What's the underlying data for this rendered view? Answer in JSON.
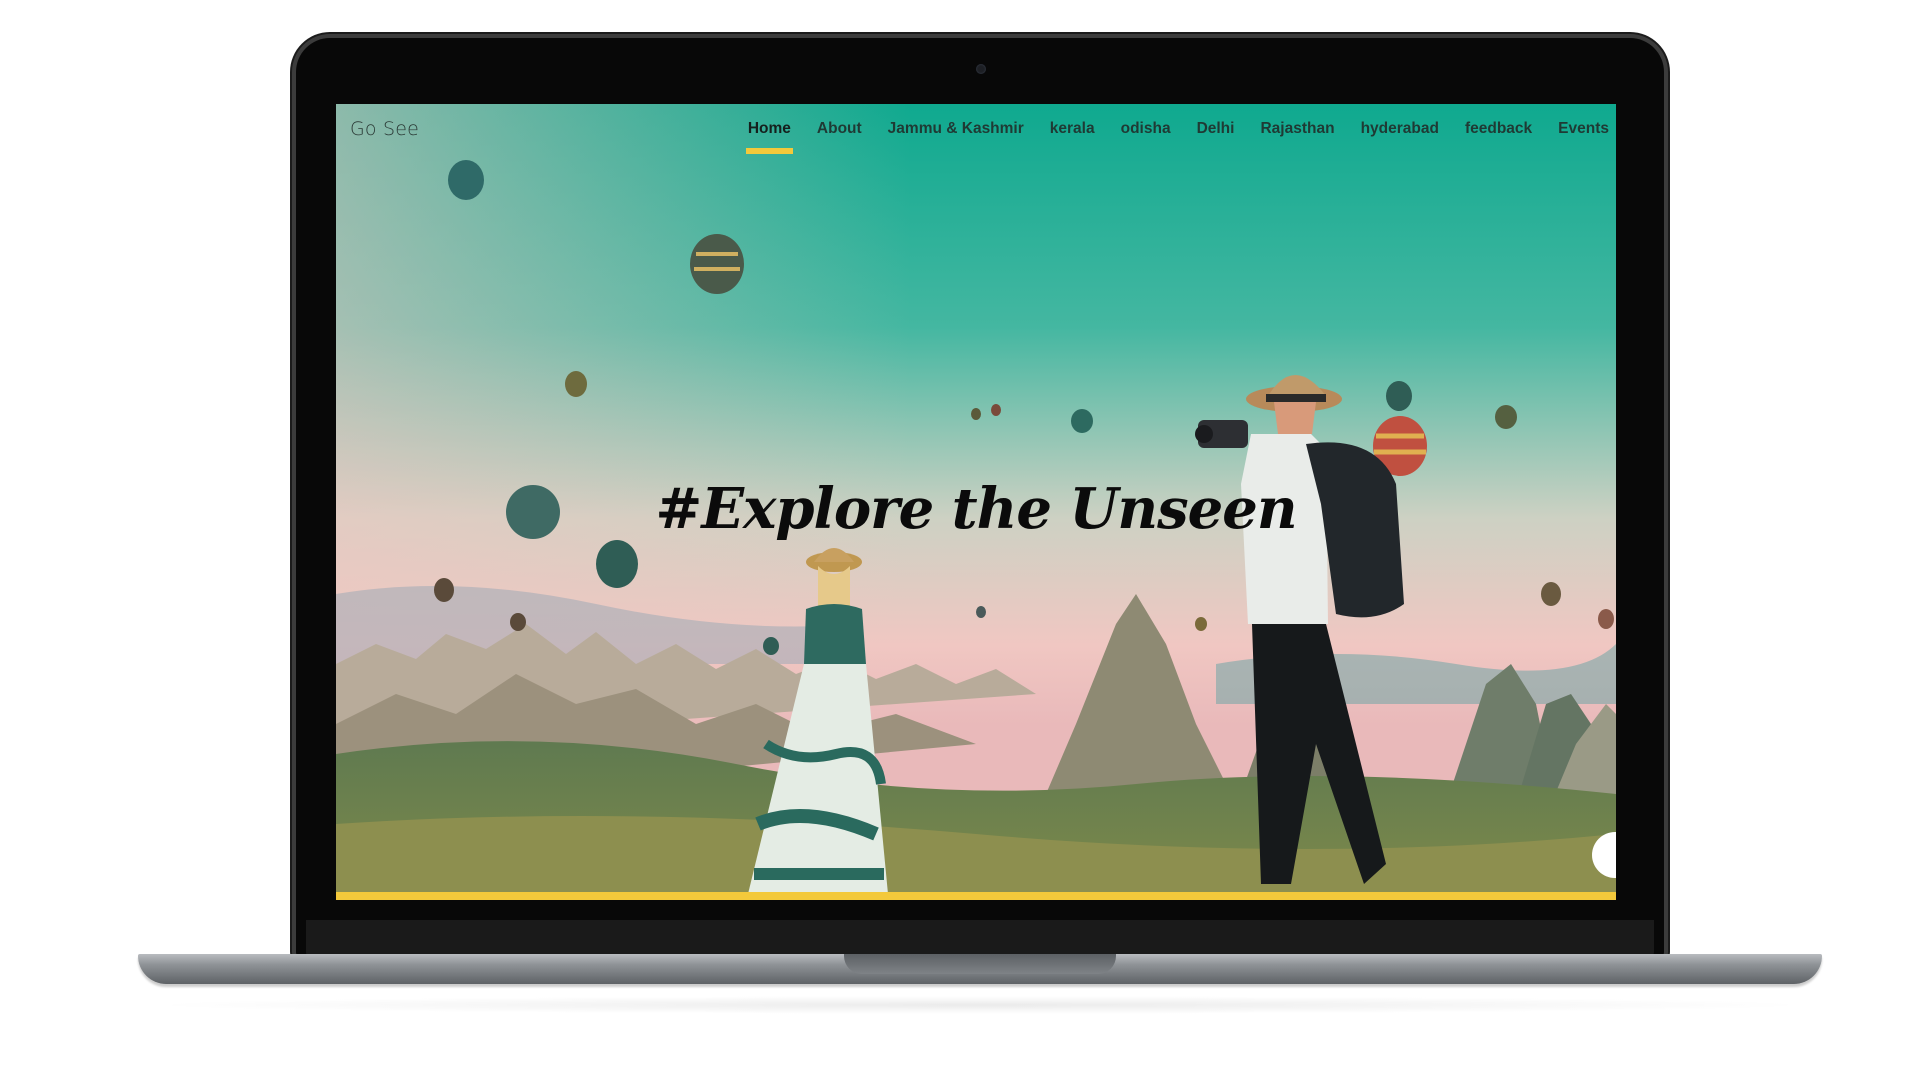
{
  "site": {
    "brand": "Go See",
    "nav": [
      {
        "label": "Home",
        "active": true
      },
      {
        "label": "About"
      },
      {
        "label": "Jammu & Kashmir"
      },
      {
        "label": "kerala"
      },
      {
        "label": "odisha"
      },
      {
        "label": "Delhi"
      },
      {
        "label": "Rajasthan"
      },
      {
        "label": "hyderabad"
      },
      {
        "label": "feedback"
      },
      {
        "label": "Events"
      }
    ]
  },
  "hero": {
    "title": "#Explore the Unseen",
    "photo": "hot-air-balloons-couple-photo"
  },
  "colors": {
    "accent": "#f3c93b",
    "sky_top": "#0fa98f",
    "sky_bottom": "#f1c6c2",
    "nav_text": "#1f3a34"
  },
  "icons": {
    "scroll": "scroll-circle-icon"
  }
}
